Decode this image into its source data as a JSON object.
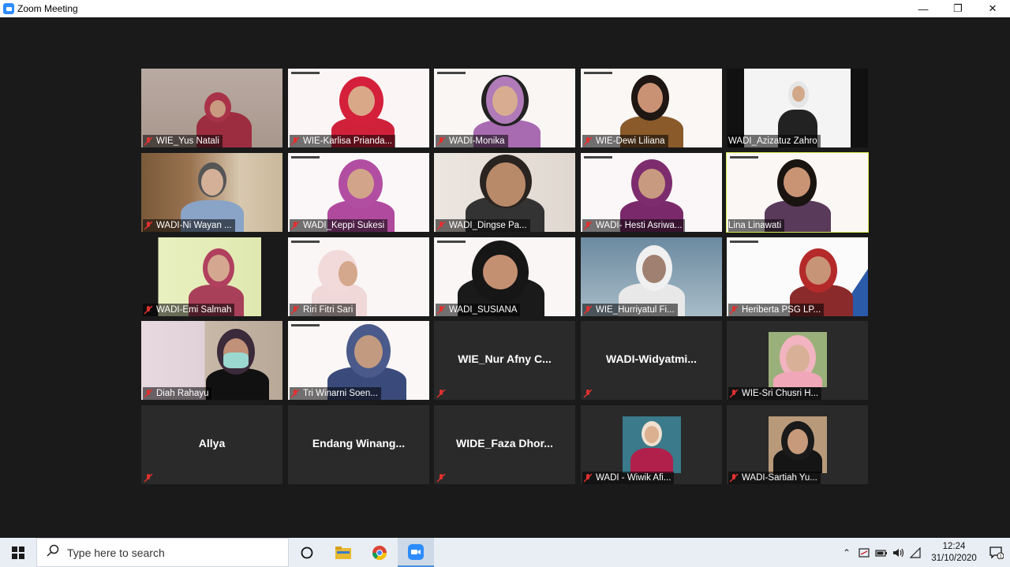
{
  "window": {
    "title": "Zoom Meeting"
  },
  "participants": [
    {
      "name": "WIE_Yus Natali"
    },
    {
      "name": "WIE-Karlisa Prianda..."
    },
    {
      "name": "WADI-Monika"
    },
    {
      "name": "WIE-Dewi Liliana"
    },
    {
      "name": "WADI_Azizatuz Zahro"
    },
    {
      "name": "WADI-Ni Wayan ..."
    },
    {
      "name": "WADI_Keppi Sukesi"
    },
    {
      "name": "WADI_Dingse Pa..."
    },
    {
      "name": "WADI- Hesti Asriwa..."
    },
    {
      "name": "Lina Linawati"
    },
    {
      "name": "WADI-Emi Salmah"
    },
    {
      "name": "Riri Fitri Sari"
    },
    {
      "name": "WADI_SUSIANA"
    },
    {
      "name": "WIE_Hurriyatul Fi..."
    },
    {
      "name": "Heriberta PSG LP..."
    },
    {
      "name": "Diah Rahayu"
    },
    {
      "name": "Tri Winarni Soen..."
    },
    {
      "name": "WIE_Nur Afny C..."
    },
    {
      "name": "WADI-Widyatmi..."
    },
    {
      "name": "WIE-Sri Chusri H..."
    },
    {
      "name": "Allya"
    },
    {
      "name": "Endang  Winang..."
    },
    {
      "name": "WIDE_Faza  Dhor..."
    },
    {
      "name": "WADI - Wiwik Afi..."
    },
    {
      "name": "WADI-Sartiah Yu..."
    }
  ],
  "taskbar": {
    "search_placeholder": "Type here to search",
    "time": "12:24",
    "date": "31/10/2020"
  },
  "colors": {
    "active_speaker": "#d8e84a",
    "mic_muted": "#e03030",
    "zoom_blue": "#2d8cff"
  }
}
